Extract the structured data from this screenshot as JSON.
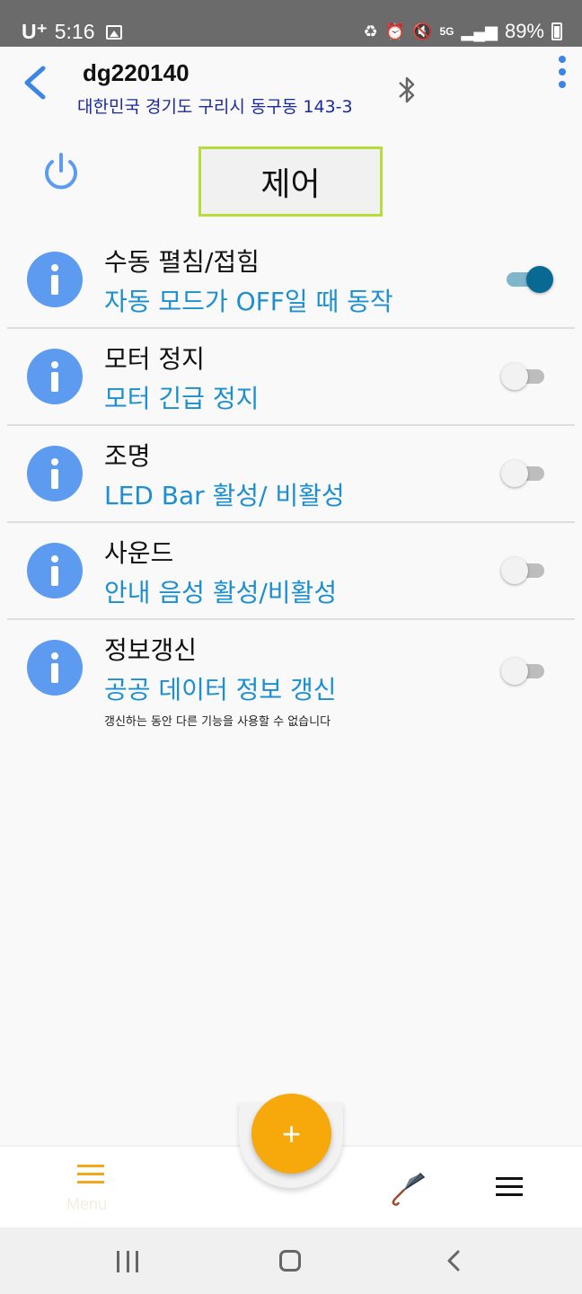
{
  "status_bar": {
    "carrier": "U⁺",
    "time": "5:16",
    "network": "5G",
    "battery": "89%"
  },
  "header": {
    "device_name": "dg220140",
    "address": "대한민국 경기도 구리시 동구동 143-3"
  },
  "control_title": "제어",
  "items": [
    {
      "title": "수동 펼침/접힘",
      "subtitle": "자동 모드가 OFF일 때 동작",
      "on": true
    },
    {
      "title": "모터 정지",
      "subtitle": "모터 긴급 정지",
      "on": false
    },
    {
      "title": "조명",
      "subtitle": "LED Bar 활성/ 비활성",
      "on": false
    },
    {
      "title": "사운드",
      "subtitle": "안내 음성 활성/비활성",
      "on": false
    },
    {
      "title": "정보갱신",
      "subtitle": "공공 데이터 정보 갱신",
      "note": "갱신하는 동안 다른 기능을 사용할 수 없습니다",
      "on": false
    }
  ],
  "bottom_nav": {
    "menu_label": "Menu",
    "fab_label": "+"
  },
  "colors": {
    "accent_blue": "#3a86e8",
    "info_icon": "#5d9bf0",
    "subtitle": "#1b8fd0",
    "toggle_on": "#086a93",
    "control_border": "#b6dd3a",
    "fab": "#f7a80a"
  },
  "icons": {
    "back": "back-arrow-icon",
    "bluetooth": "bluetooth-icon",
    "more": "more-vertical-icon",
    "power": "power-icon",
    "info": "info-icon",
    "menu": "menu-icon",
    "umbrella": "umbrella-icon",
    "hamburger": "hamburger-icon"
  }
}
